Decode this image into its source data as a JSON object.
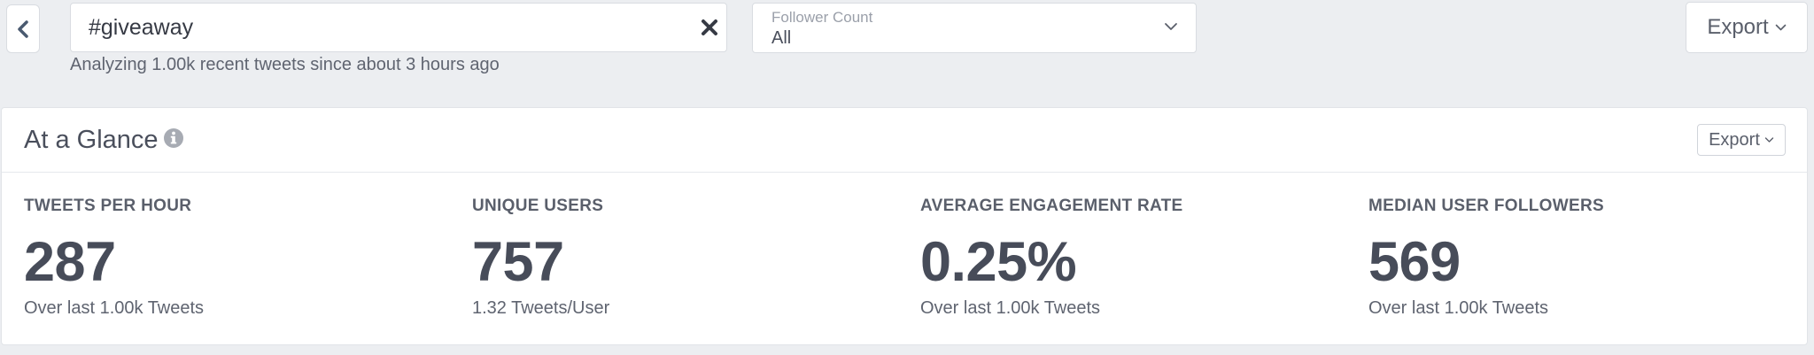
{
  "search": {
    "value": "#giveaway",
    "caption": "Analyzing 1.00k recent tweets since about 3 hours ago"
  },
  "follower_filter": {
    "label": "Follower Count",
    "value": "All"
  },
  "toolbar": {
    "export_label": "Export"
  },
  "at_a_glance": {
    "title": "At a Glance",
    "export_label": "Export",
    "stats": [
      {
        "label": "Tweets per hour",
        "value": "287",
        "note": "Over last 1.00k Tweets"
      },
      {
        "label": "Unique users",
        "value": "757",
        "note": "1.32 Tweets/User"
      },
      {
        "label": "Average engagement rate",
        "value": "0.25%",
        "note": "Over last 1.00k Tweets"
      },
      {
        "label": "Median user followers",
        "value": "569",
        "note": "Over last 1.00k Tweets"
      }
    ]
  },
  "icons": {
    "back": "chevron-left-icon",
    "clear": "close-icon",
    "dropdown": "chevron-down-icon",
    "info": "info-icon"
  },
  "colors": {
    "background": "#eceef1",
    "text": "#4a4f5c",
    "stat_value": "#474c59"
  }
}
